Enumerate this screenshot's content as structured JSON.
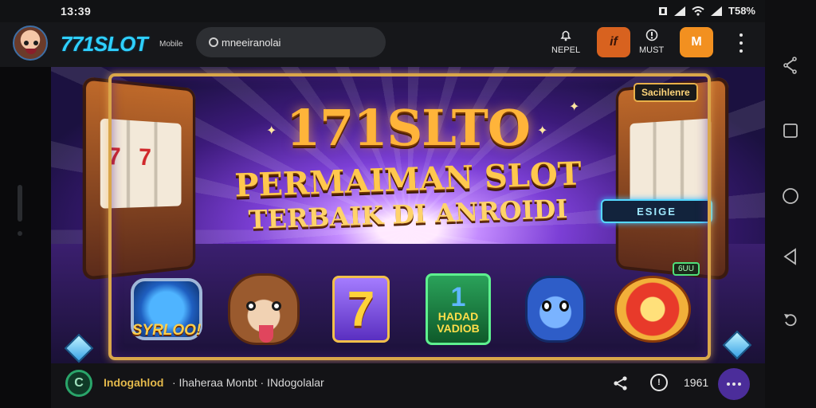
{
  "status_bar": {
    "time": "13:39",
    "battery": "T58%",
    "icons": [
      "nfc-icon",
      "signal-icon",
      "wifi-icon",
      "signal-icon"
    ]
  },
  "header": {
    "brand": "771SLOT",
    "brand_suffix": "Mobile",
    "search_text": "mneeiranolai",
    "item1_label": "NEPEL",
    "button1_label": "if",
    "item2_label": "MUST",
    "button2_label": "M",
    "colors": {
      "brand": "#2fd0ff",
      "accent1": "#d8621f",
      "accent2": "#f29020"
    }
  },
  "banner": {
    "title_line1": "171SLTO",
    "title_line2": "PERMAIMAN SLOT",
    "title_line3": "TERBAIK DI ANROIDI",
    "corner_badge": "Sacihlenre",
    "neon_sign": "ESIGE",
    "small_badge": "6UU",
    "games": [
      {
        "name": "shield-game",
        "label": "SYRLOO!"
      },
      {
        "name": "dog-game",
        "label": ""
      },
      {
        "name": "seven-game",
        "label": "7"
      },
      {
        "name": "card-game",
        "label_big": "1",
        "label_1": "HADAD",
        "label_2": "VADIOB"
      },
      {
        "name": "bear-game",
        "label": ""
      },
      {
        "name": "coin-game",
        "label": ""
      }
    ]
  },
  "bottom_bar": {
    "channel_avatar": "C",
    "channel_name": "Indogahlod",
    "meta": "· Ihaheraa Monbt · INdogolalar",
    "count": "1961",
    "icon_2_text": "!"
  }
}
